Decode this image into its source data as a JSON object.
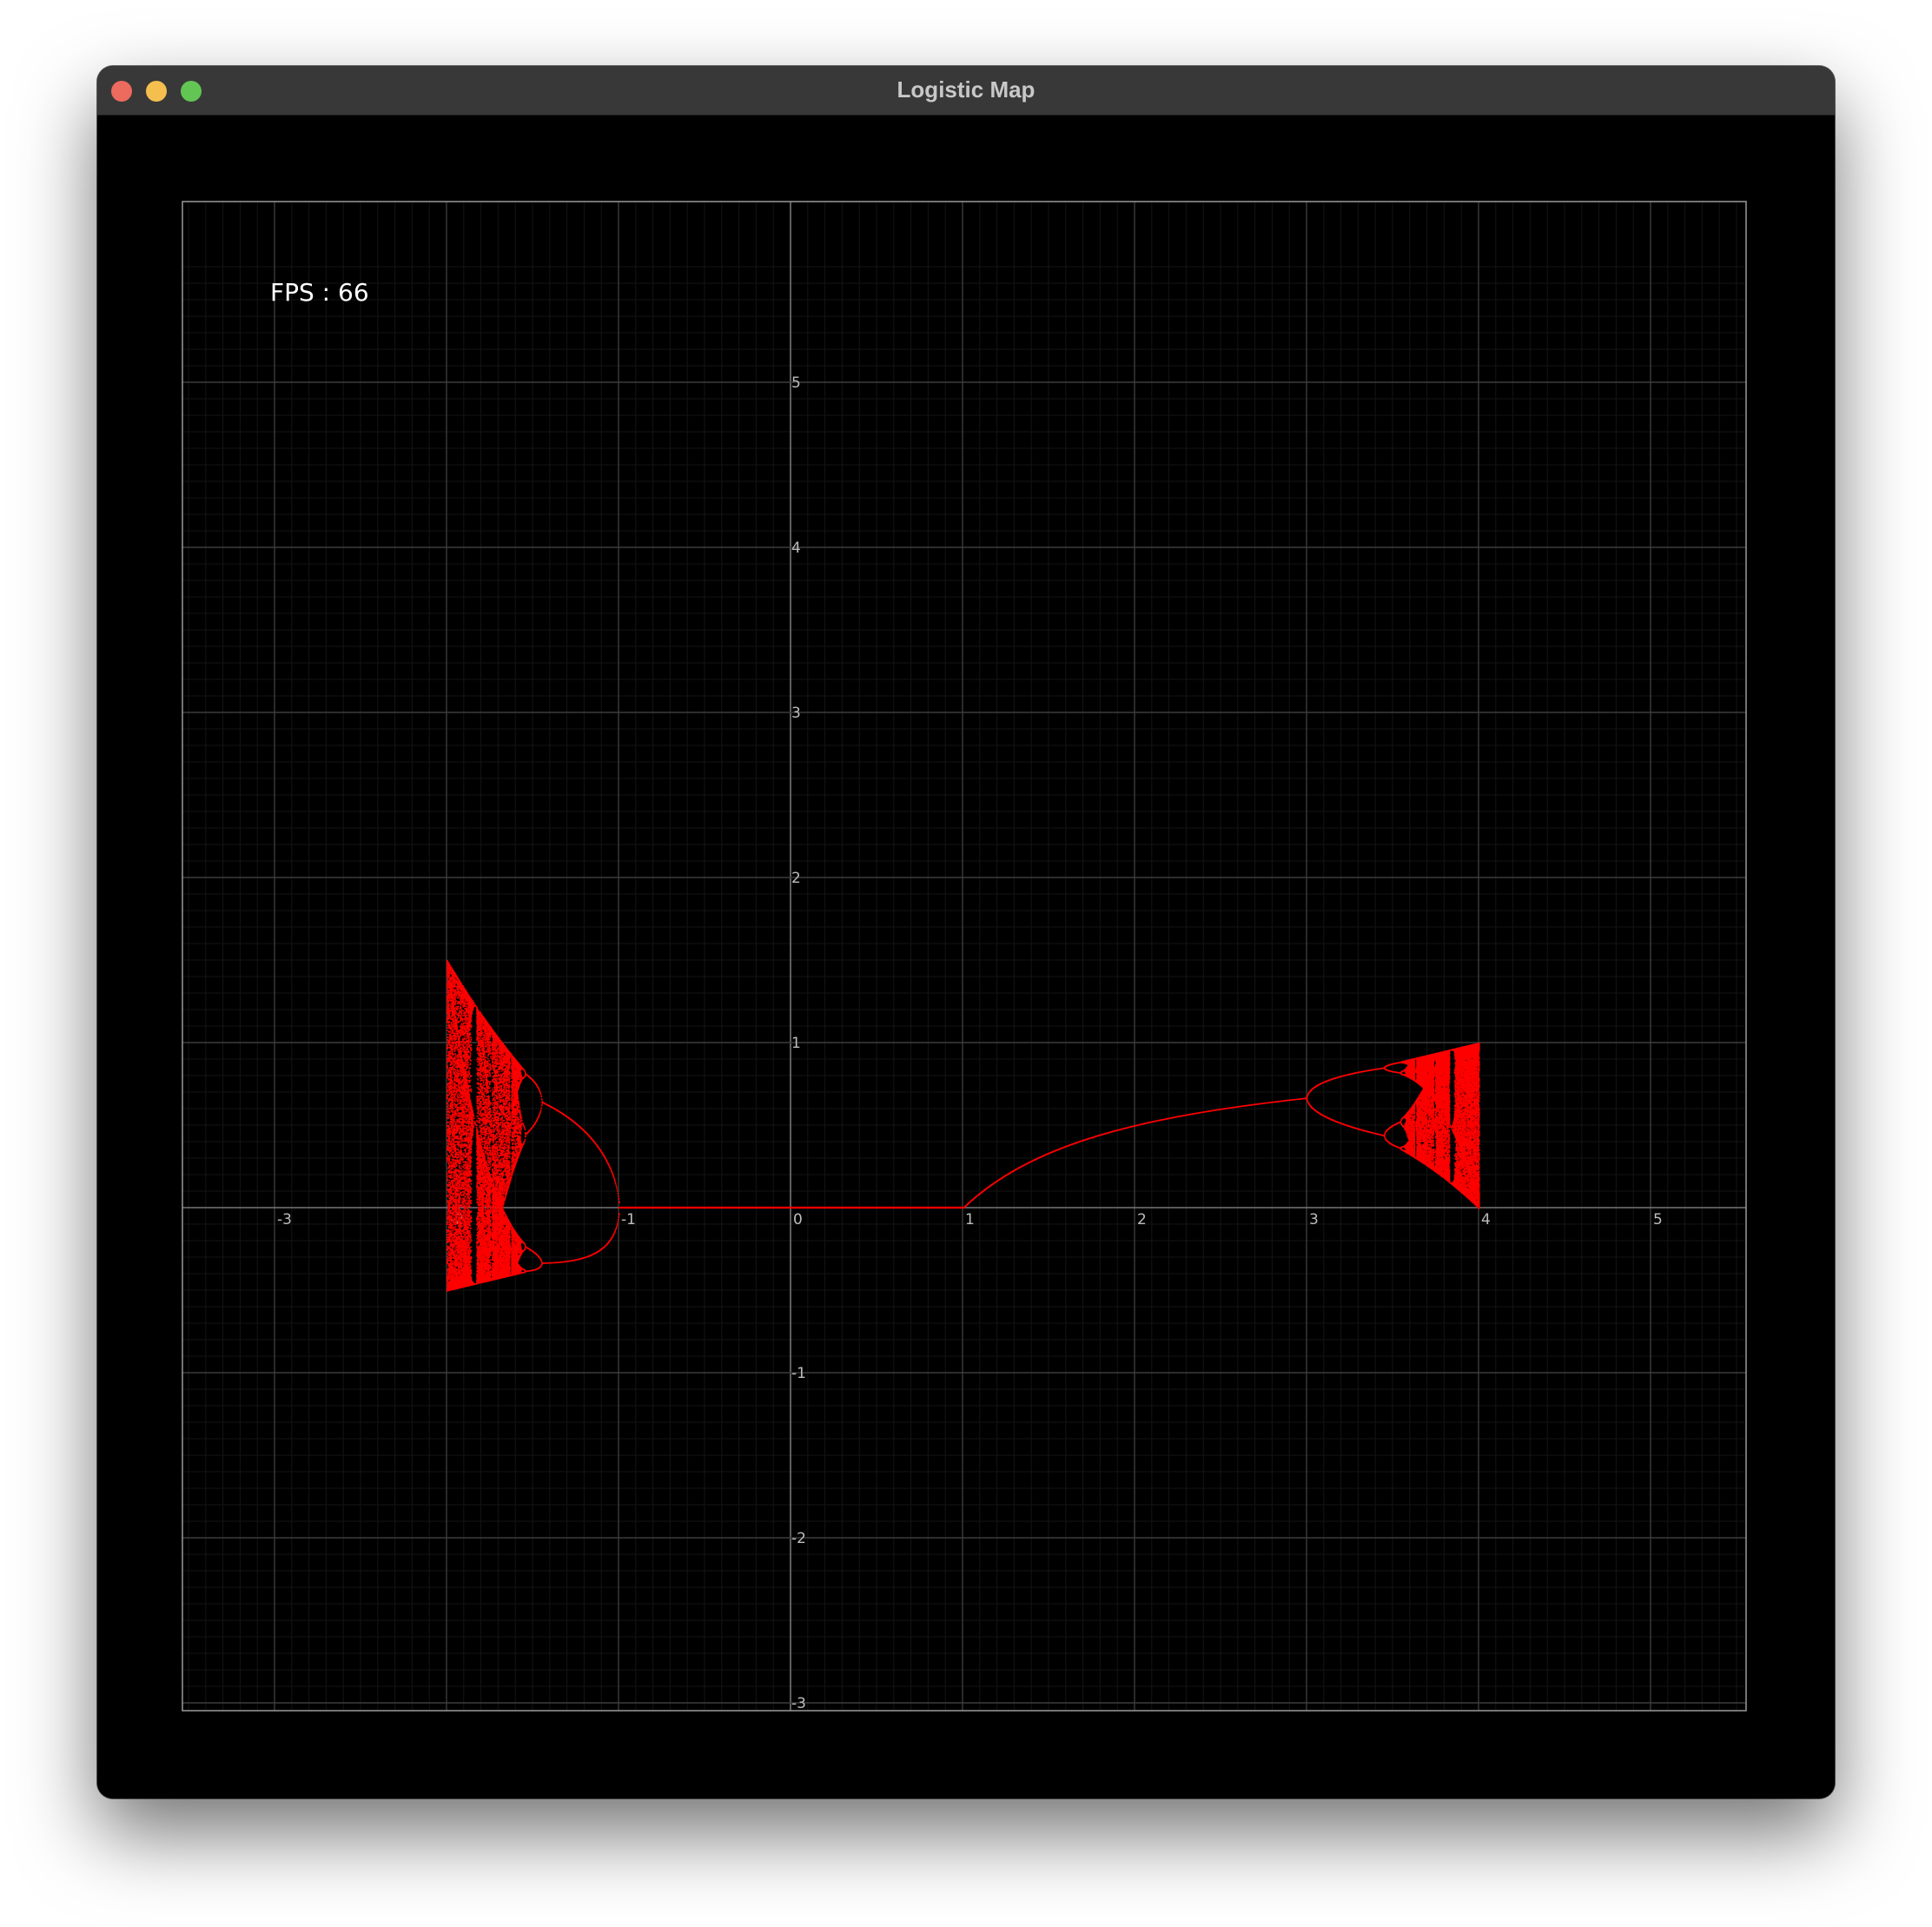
{
  "window": {
    "title": "Logistic Map",
    "controls": {
      "close_color": "#ed6a5e",
      "minimize_color": "#f5bf4f",
      "maximize_color": "#62c554"
    }
  },
  "hud": {
    "fps_text": "FPS : 66"
  },
  "colors": {
    "background": "#000000",
    "plot": "#ff0000",
    "grid_major": "#3c3c3c",
    "grid_minor": "#141414",
    "axis": "#777777",
    "text": "#ffffff"
  },
  "chart_data": {
    "type": "scatter",
    "title": "",
    "xlabel": "",
    "ylabel": "",
    "xlim": [
      -3.5,
      5.6
    ],
    "ylim": [
      -3.4,
      5.7
    ],
    "grid": true,
    "x_ticks": [
      "-3",
      "-2",
      "-1",
      "0",
      "1",
      "2",
      "3",
      "4",
      "5"
    ],
    "y_ticks": [
      "5",
      "4",
      "3",
      "2",
      "1",
      "-1",
      "-2",
      "-3"
    ],
    "series": [
      {
        "map": "x_next = r * x * (1 - x)",
        "r_range": [
          1,
          4
        ],
        "note_stable_fixed_point_at_r_3": 0.667,
        "max_at_r_4": 1.0
      },
      {
        "map": "x_next = r * x * (1 - x)",
        "r_range": [
          -2,
          -1
        ],
        "max_at_r_minus_2": 1.5,
        "min_at_r_minus_2": -0.5
      },
      {
        "segment": "y = 0",
        "r_range": [
          -1,
          1
        ]
      }
    ]
  }
}
